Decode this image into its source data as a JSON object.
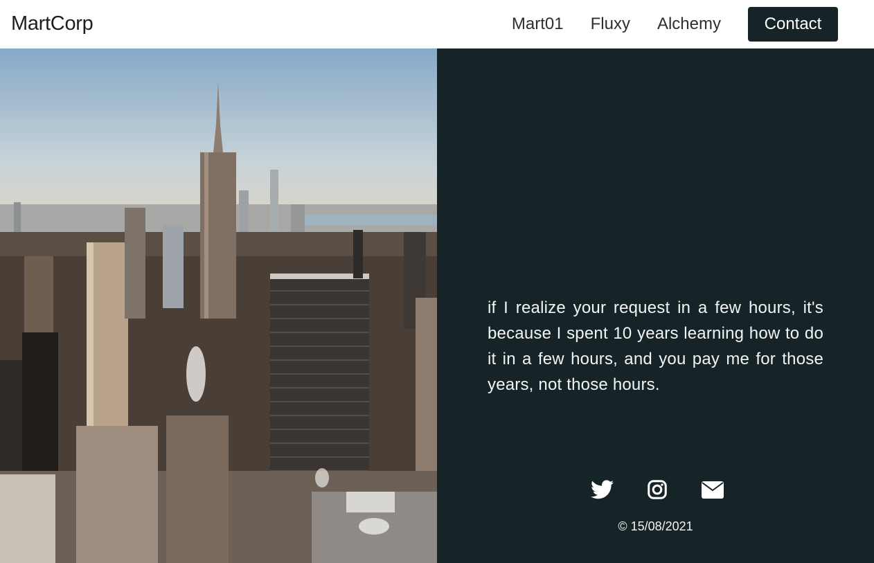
{
  "brand": "MartCorp",
  "nav": {
    "links": [
      "Mart01",
      "Fluxy",
      "Alchemy"
    ],
    "contact_label": "Contact"
  },
  "hero": {
    "image_alt": "city skyline photo"
  },
  "quote": "if I realize your request in a few hours, it's because I spent 10 years learning how to do it in a few hours, and you pay me for those years, not those hours.",
  "socials": [
    "twitter-icon",
    "instagram-icon",
    "mail-icon"
  ],
  "footer": {
    "copyright": "© 15/08/2021"
  },
  "colors": {
    "panel": "#172427",
    "button": "#172427",
    "text_light": "#f3f4f4"
  }
}
